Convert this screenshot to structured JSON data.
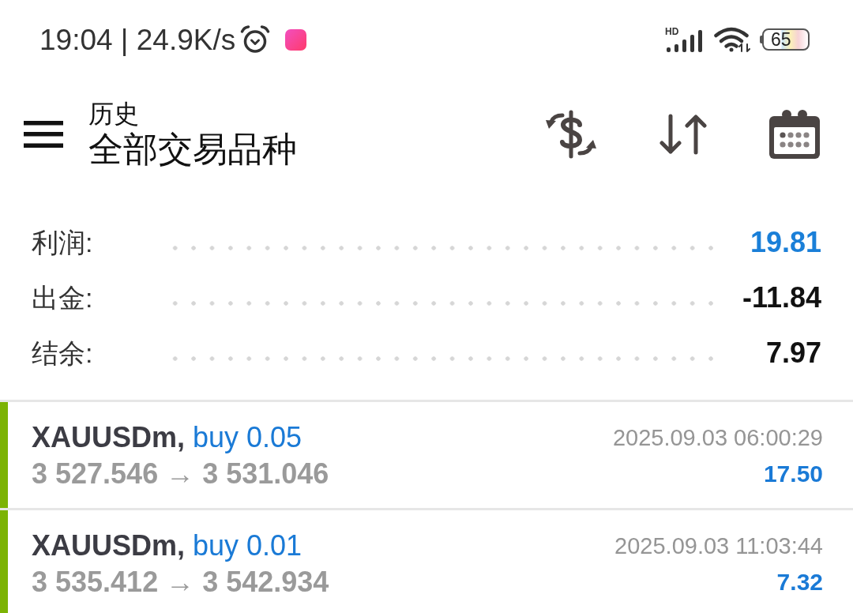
{
  "status_bar": {
    "time_and_speed": "19:04 | 24.9K/s",
    "network_label": "HD",
    "battery": "65"
  },
  "header": {
    "subtitle": "历史",
    "title": "全部交易品种"
  },
  "summary": [
    {
      "label": "利润:",
      "value": "19.81",
      "color": "#1a7fd8"
    },
    {
      "label": "出金:",
      "value": "-11.84",
      "color": "#111111"
    },
    {
      "label": "结余:",
      "value": "7.97",
      "color": "#111111"
    }
  ],
  "deals": [
    {
      "symbol": "XAUUSDm,",
      "side": "buy 0.05",
      "prices": "3 527.546 → 3 531.046",
      "time": "2025.09.03 06:00:29",
      "profit": "17.50",
      "color": "#7cb305"
    },
    {
      "symbol": "XAUUSDm,",
      "side": "buy 0.01",
      "prices": "3 535.412 → 3 542.934",
      "time": "2025.09.03 11:03:44",
      "profit": "7.32",
      "color": "#7cb305"
    }
  ]
}
